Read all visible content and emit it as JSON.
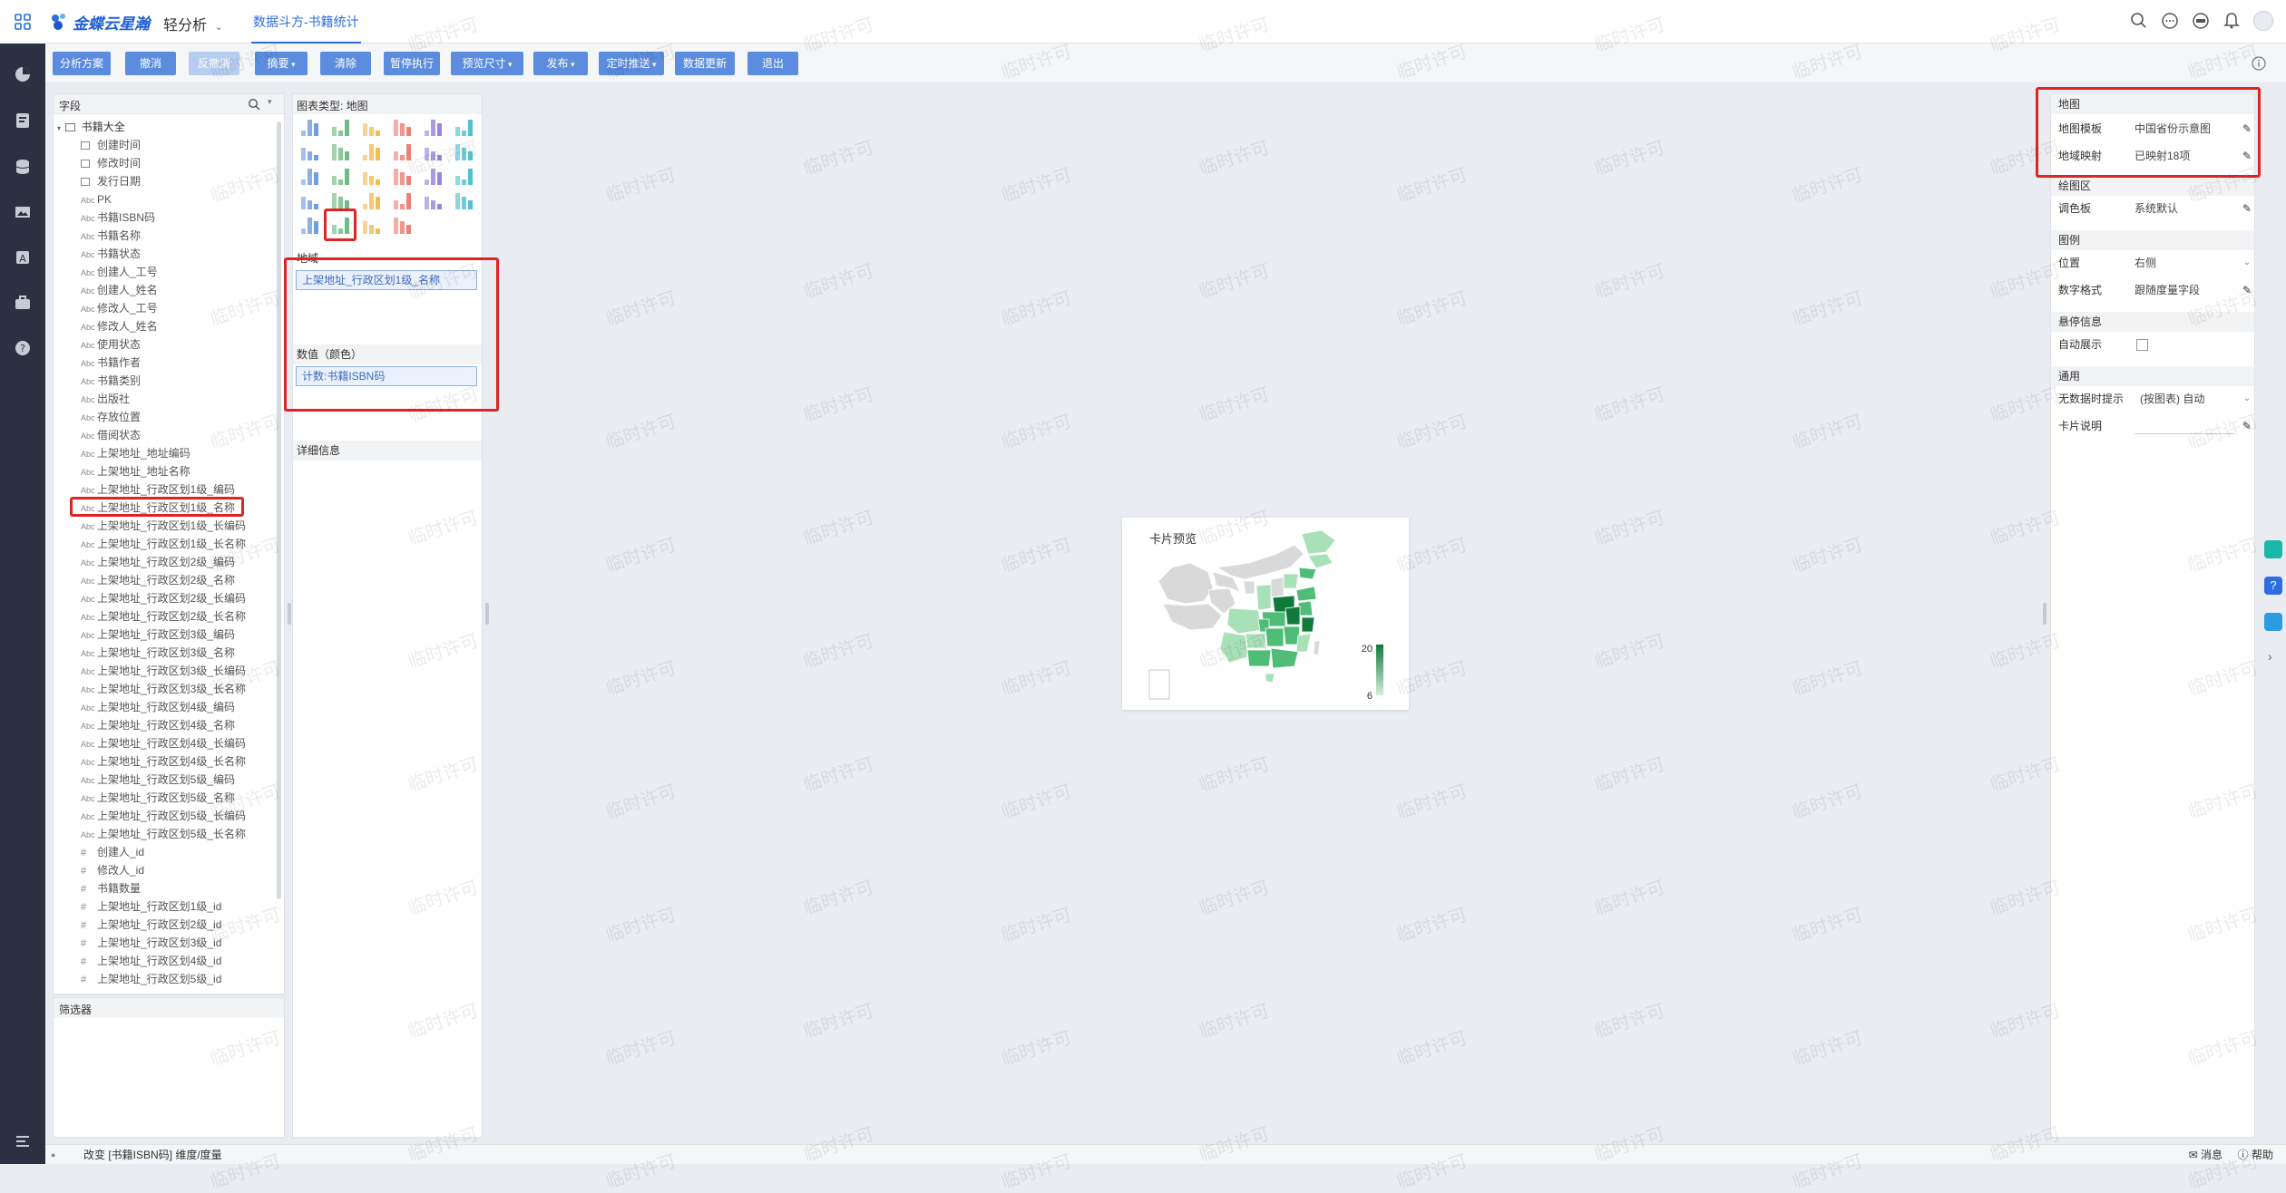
{
  "app": {
    "logo_text": "金蝶云星瀚",
    "module": "轻分析",
    "tab": "数据斗方-书籍统计"
  },
  "toolbar": {
    "buttons": [
      {
        "label": "分析方案",
        "dropdown": false,
        "disabled": false
      },
      {
        "label": "撤消",
        "dropdown": false,
        "disabled": false
      },
      {
        "label": "反撤消",
        "dropdown": false,
        "disabled": true
      },
      {
        "label": "摘要",
        "dropdown": true,
        "disabled": false
      },
      {
        "label": "清除",
        "dropdown": false,
        "disabled": false
      },
      {
        "label": "暂停执行",
        "dropdown": false,
        "disabled": false
      },
      {
        "label": "预览尺寸",
        "dropdown": true,
        "disabled": false
      },
      {
        "label": "发布",
        "dropdown": true,
        "disabled": false
      },
      {
        "label": "定时推送",
        "dropdown": true,
        "disabled": false
      },
      {
        "label": "数据更新",
        "dropdown": false,
        "disabled": false
      },
      {
        "label": "退出",
        "dropdown": false,
        "disabled": false
      }
    ]
  },
  "fields": {
    "title": "字段",
    "root": "书籍大全",
    "items": [
      {
        "type": "date",
        "label": "创建时间"
      },
      {
        "type": "date",
        "label": "修改时间"
      },
      {
        "type": "date",
        "label": "发行日期"
      },
      {
        "type": "Abc",
        "label": "PK"
      },
      {
        "type": "Abc",
        "label": "书籍ISBN码"
      },
      {
        "type": "Abc",
        "label": "书籍名称"
      },
      {
        "type": "Abc",
        "label": "书籍状态"
      },
      {
        "type": "Abc",
        "label": "创建人_工号"
      },
      {
        "type": "Abc",
        "label": "创建人_姓名"
      },
      {
        "type": "Abc",
        "label": "修改人_工号"
      },
      {
        "type": "Abc",
        "label": "修改人_姓名"
      },
      {
        "type": "Abc",
        "label": "使用状态"
      },
      {
        "type": "Abc",
        "label": "书籍作者"
      },
      {
        "type": "Abc",
        "label": "书籍类别"
      },
      {
        "type": "Abc",
        "label": "出版社"
      },
      {
        "type": "Abc",
        "label": "存放位置"
      },
      {
        "type": "Abc",
        "label": "借阅状态"
      },
      {
        "type": "Abc",
        "label": "上架地址_地址编码"
      },
      {
        "type": "Abc",
        "label": "上架地址_地址名称"
      },
      {
        "type": "Abc",
        "label": "上架地址_行政区划1级_编码"
      },
      {
        "type": "Abc",
        "label": "上架地址_行政区划1级_名称"
      },
      {
        "type": "Abc",
        "label": "上架地址_行政区划1级_长编码"
      },
      {
        "type": "Abc",
        "label": "上架地址_行政区划1级_长名称"
      },
      {
        "type": "Abc",
        "label": "上架地址_行政区划2级_编码"
      },
      {
        "type": "Abc",
        "label": "上架地址_行政区划2级_名称"
      },
      {
        "type": "Abc",
        "label": "上架地址_行政区划2级_长编码"
      },
      {
        "type": "Abc",
        "label": "上架地址_行政区划2级_长名称"
      },
      {
        "type": "Abc",
        "label": "上架地址_行政区划3级_编码"
      },
      {
        "type": "Abc",
        "label": "上架地址_行政区划3级_名称"
      },
      {
        "type": "Abc",
        "label": "上架地址_行政区划3级_长编码"
      },
      {
        "type": "Abc",
        "label": "上架地址_行政区划3级_长名称"
      },
      {
        "type": "Abc",
        "label": "上架地址_行政区划4级_编码"
      },
      {
        "type": "Abc",
        "label": "上架地址_行政区划4级_名称"
      },
      {
        "type": "Abc",
        "label": "上架地址_行政区划4级_长编码"
      },
      {
        "type": "Abc",
        "label": "上架地址_行政区划4级_长名称"
      },
      {
        "type": "Abc",
        "label": "上架地址_行政区划5级_编码"
      },
      {
        "type": "Abc",
        "label": "上架地址_行政区划5级_名称"
      },
      {
        "type": "Abc",
        "label": "上架地址_行政区划5级_长编码"
      },
      {
        "type": "Abc",
        "label": "上架地址_行政区划5级_长名称"
      },
      {
        "type": "#",
        "label": "创建人_id"
      },
      {
        "type": "#",
        "label": "修改人_id"
      },
      {
        "type": "#",
        "label": "书籍数量"
      },
      {
        "type": "#",
        "label": "上架地址_行政区划1级_id"
      },
      {
        "type": "#",
        "label": "上架地址_行政区划2级_id"
      },
      {
        "type": "#",
        "label": "上架地址_行政区划3级_id"
      },
      {
        "type": "#",
        "label": "上架地址_行政区划4级_id"
      },
      {
        "type": "#",
        "label": "上架地址_行政区划5级_id"
      }
    ],
    "highlighted_label": "上架地址_行政区划1级_名称",
    "filter_title": "筛选器"
  },
  "chart_type": {
    "label": "图表类型: 地图",
    "region_label": "地域",
    "region_value": "上架地址_行政区划1级_名称",
    "value_label": "数值（颜色）",
    "value_value": "计数:书籍ISBN码",
    "detail_label": "详细信息",
    "icon_colors": [
      "#5b8cde",
      "#57b06e",
      "#f2b134",
      "#e96b5f",
      "#8a6fd8",
      "#34b6c9"
    ]
  },
  "preview": {
    "title": "卡片预览",
    "legend_max": "20",
    "legend_min": "6",
    "colors": {
      "light": "#d9d9d9",
      "low": "#a8e0b8",
      "mid": "#4fbd78",
      "high": "#0f7a3a"
    }
  },
  "props": {
    "sections": {
      "map": "地图",
      "plot": "绘图区",
      "legend": "图例",
      "hover": "悬停信息",
      "general": "通用"
    },
    "rows": {
      "map_template_label": "地图模板",
      "map_template_value": "中国省份示意图",
      "region_map_label": "地域映射",
      "region_map_value": "已映射18项",
      "palette_label": "调色板",
      "palette_value": "系统默认",
      "position_label": "位置",
      "position_value": "右侧",
      "numfmt_label": "数字格式",
      "numfmt_value": "跟随度量字段",
      "autoshow_label": "自动展示",
      "nodata_label": "无数据时提示",
      "nodata_value": "(按图表) 自动",
      "card_desc_label": "卡片说明"
    }
  },
  "status": {
    "text": "改变 [书籍ISBN码] 维度/度量",
    "msg": "消息",
    "help": "帮助"
  },
  "watermark": "临时许可"
}
